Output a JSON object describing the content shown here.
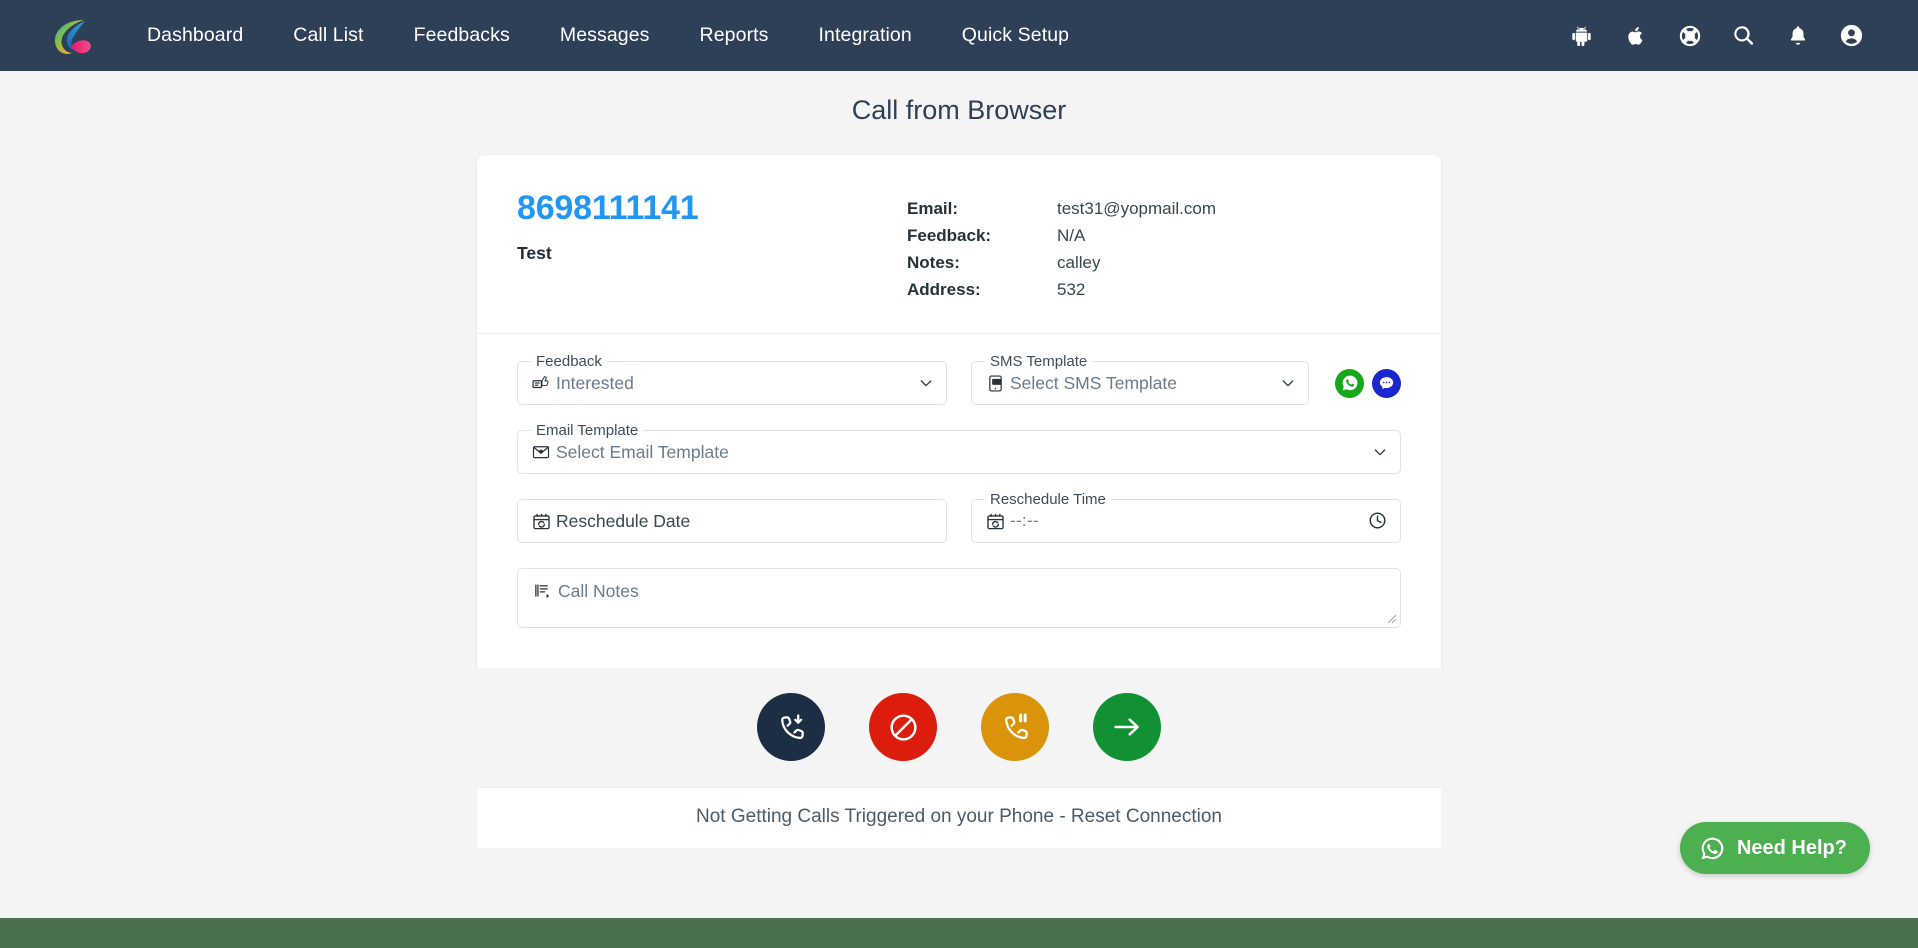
{
  "navbar": {
    "brand_logo_icon": "calley-logo-icon",
    "links": [
      {
        "label": "Dashboard",
        "name": "dashboard"
      },
      {
        "label": "Call List",
        "name": "call-list"
      },
      {
        "label": "Feedbacks",
        "name": "feedbacks"
      },
      {
        "label": "Messages",
        "name": "messages"
      },
      {
        "label": "Reports",
        "name": "reports"
      },
      {
        "label": "Integration",
        "name": "integration"
      },
      {
        "label": "Quick Setup",
        "name": "quick-setup"
      }
    ],
    "icons": [
      {
        "name": "android-icon"
      },
      {
        "name": "apple-icon"
      },
      {
        "name": "lifebuoy-support-icon"
      },
      {
        "name": "search-icon"
      },
      {
        "name": "bell-notification-icon"
      },
      {
        "name": "user-account-icon"
      }
    ],
    "background_color": "#2e4057"
  },
  "page": {
    "title": "Call from Browser",
    "background_color": "#f4f4f4"
  },
  "contact": {
    "phone_number": "8698111141",
    "name": "Test",
    "accent_color": "#2196f3",
    "details": [
      {
        "label": "Email:",
        "value": "test31@yopmail.com"
      },
      {
        "label": "Feedback:",
        "value": "N/A"
      },
      {
        "label": "Notes:",
        "value": "calley"
      },
      {
        "label": "Address:",
        "value": "532"
      }
    ]
  },
  "form": {
    "feedback": {
      "label": "Feedback",
      "value": "Interested",
      "icon": "feedback-thumbs-icon"
    },
    "sms_template": {
      "label": "SMS Template",
      "value": "Select SMS Template",
      "icon": "mobile-sms-icon"
    },
    "whatsapp_button": {
      "name": "whatsapp-send-button",
      "color": "#17a81a",
      "icon": "whatsapp-icon"
    },
    "sms_button": {
      "name": "sms-send-button",
      "color": "#1a27cf",
      "icon": "message-bubble-icon"
    },
    "email_template": {
      "label": "Email Template",
      "value": "Select Email Template",
      "icon": "email-envelope-icon"
    },
    "reschedule_date": {
      "placeholder": "Reschedule Date",
      "icon": "calendar-refresh-icon"
    },
    "reschedule_time": {
      "label": "Reschedule Time",
      "value": "--:--",
      "icon": "calendar-refresh-icon",
      "trailing_icon": "clock-icon"
    },
    "call_notes": {
      "placeholder": "Call Notes",
      "icon": "call-notes-icon"
    }
  },
  "actions": [
    {
      "name": "answer-call-button",
      "icon": "phone-incoming-icon",
      "color": "#1c2e44"
    },
    {
      "name": "reject-call-button",
      "icon": "block-prohibit-icon",
      "color": "#dc1c0d"
    },
    {
      "name": "hold-call-button",
      "icon": "phone-pause-icon",
      "color": "#d9940b"
    },
    {
      "name": "next-call-button",
      "icon": "arrow-right-icon",
      "color": "#119133"
    }
  ],
  "reset": {
    "text": "Not Getting Calls Triggered on your Phone - Reset Connection"
  },
  "need_help": {
    "label": "Need Help?",
    "icon": "whatsapp-icon",
    "color": "#4caf50"
  },
  "footer": {
    "color": "#4a7050"
  }
}
